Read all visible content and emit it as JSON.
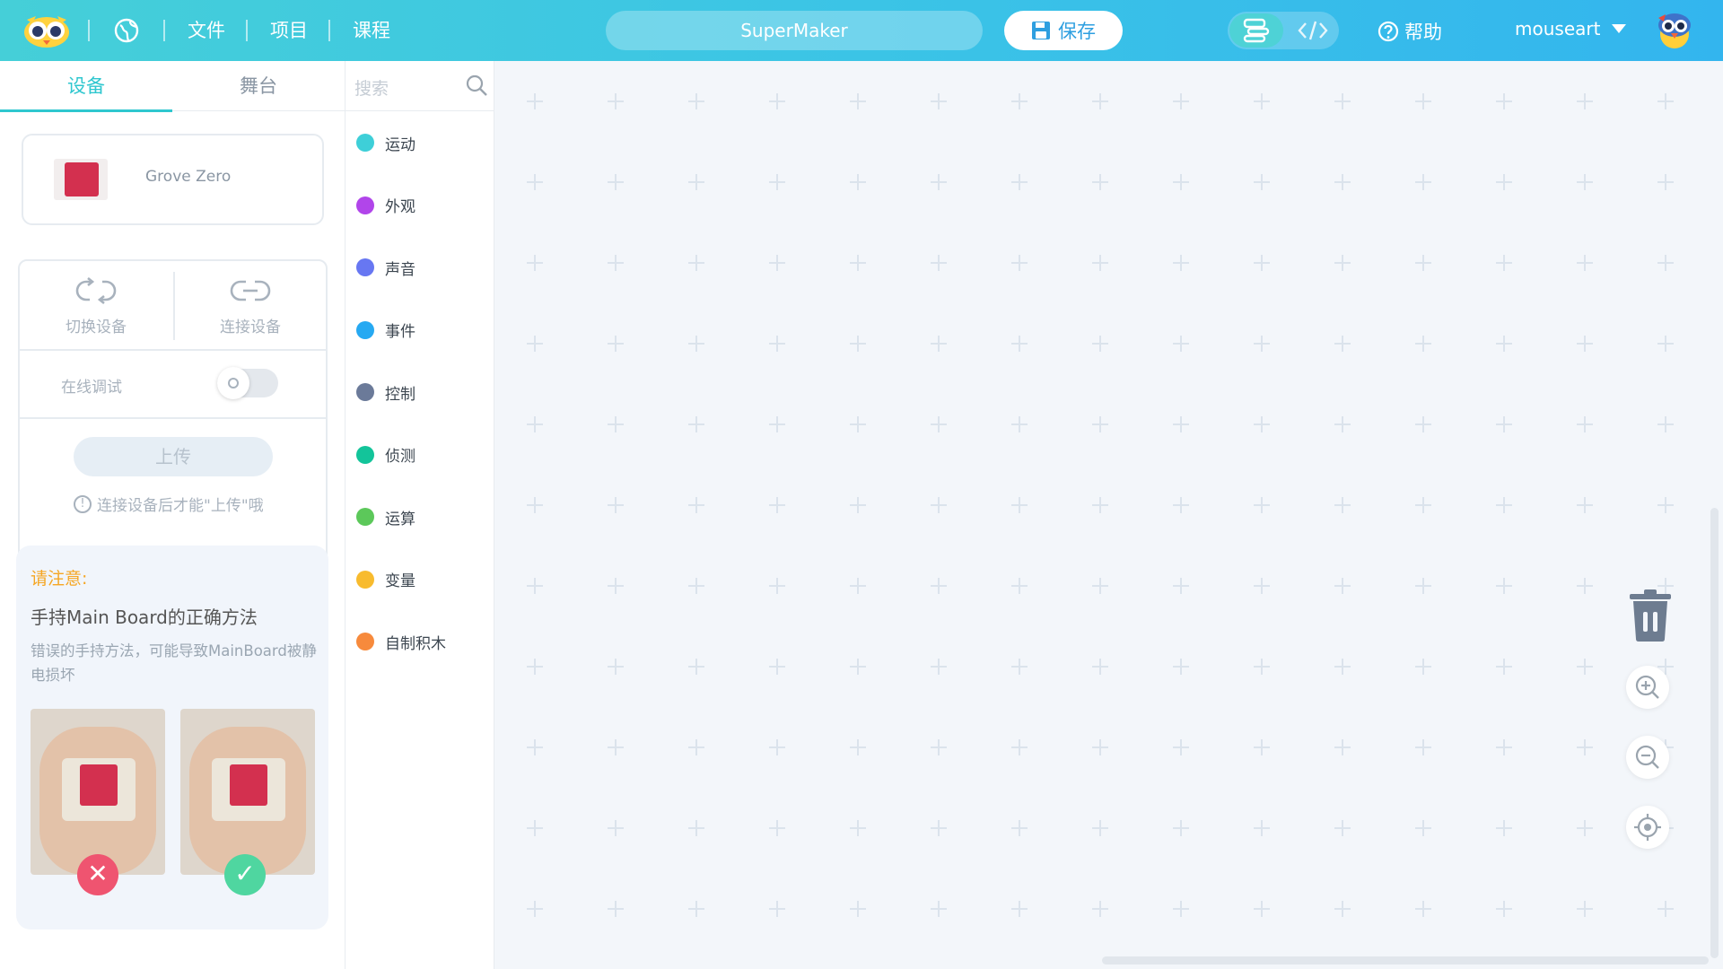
{
  "topbar": {
    "menu": [
      "文件",
      "项目",
      "课程"
    ],
    "project_name": "SuperMaker",
    "save_label": "保存",
    "help_label": "帮助",
    "username": "mouseart"
  },
  "left_tabs": [
    "设备",
    "舞台"
  ],
  "device": {
    "name": "Grove Zero"
  },
  "controls": {
    "switch_device": "切换设备",
    "connect_device": "连接设备",
    "online_debug": "在线调试",
    "upload": "上传",
    "upload_tip": "连接设备后才能\"上传\"哦"
  },
  "notice": {
    "title": "请注意:",
    "heading": "手持Main Board的正确方法",
    "desc": "错误的手持方法，可能导致MainBoard被静电损坏"
  },
  "search": {
    "placeholder": "搜索"
  },
  "categories": [
    {
      "label": "运动",
      "color": "#3ecfd8"
    },
    {
      "label": "外观",
      "color": "#b145ea"
    },
    {
      "label": "声音",
      "color": "#6777f2"
    },
    {
      "label": "事件",
      "color": "#26a9f2"
    },
    {
      "label": "控制",
      "color": "#6b7a99"
    },
    {
      "label": "侦测",
      "color": "#13c49a"
    },
    {
      "label": "运算",
      "color": "#5cc85a"
    },
    {
      "label": "变量",
      "color": "#f8bb2e"
    },
    {
      "label": "自制积木",
      "color": "#f78a3c"
    }
  ]
}
